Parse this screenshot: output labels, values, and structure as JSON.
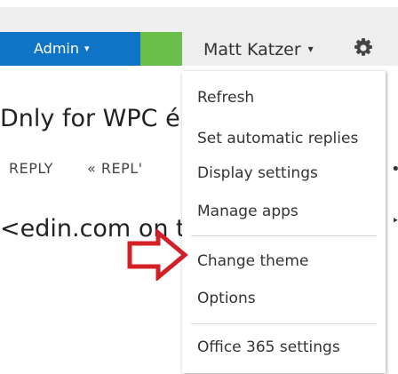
{
  "header": {
    "admin_label": "Admin",
    "user_name": "Matt Katzer",
    "admin_color": "#0f74c5",
    "tile_color": "#6abf4b"
  },
  "mail": {
    "subject": "Dnly for WPC é",
    "reply": "REPLY",
    "reply_all": "REPL'",
    "from": "<edin.com on t"
  },
  "menu": {
    "items": [
      "Refresh",
      "Set automatic replies",
      "Display settings",
      "Manage apps",
      "Change theme",
      "Options",
      "Office 365 settings"
    ]
  },
  "annotation": {
    "arrow_icon": "right-arrow-icon",
    "arrow_color": "#d31f26"
  }
}
